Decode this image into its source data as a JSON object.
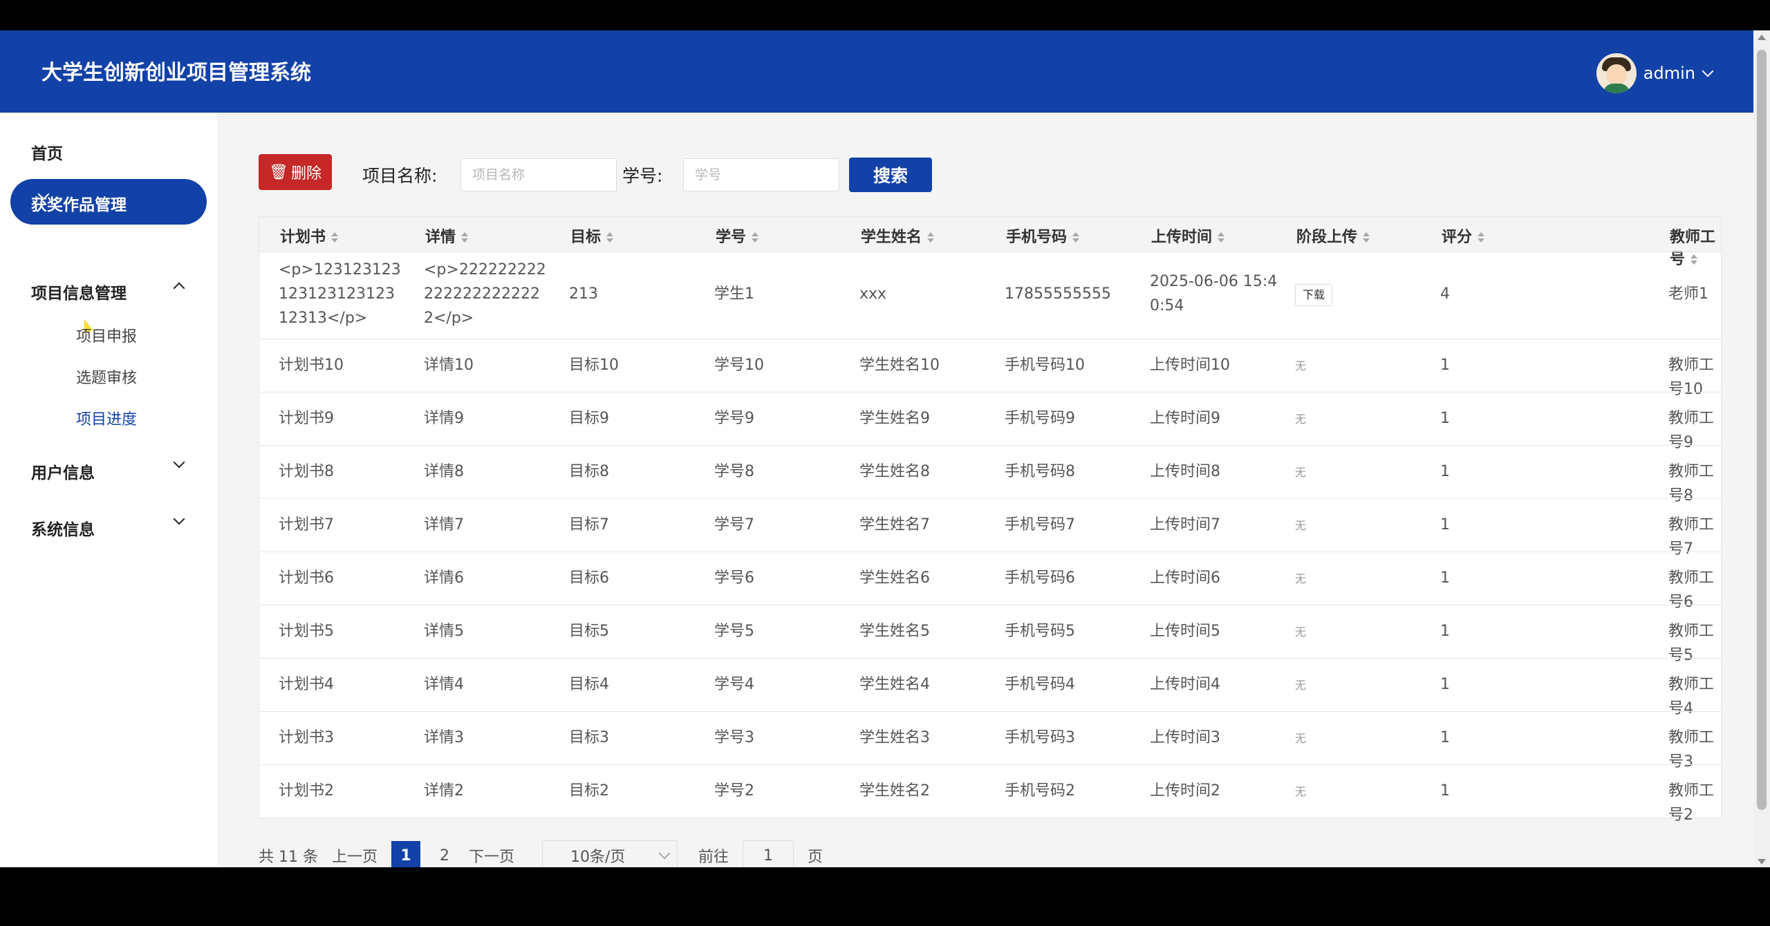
{
  "header": {
    "title": "大学生创新创业项目管理系统",
    "user": "admin"
  },
  "sidebar": {
    "home": "首页",
    "awards": "获奖作品管理",
    "project_info": "项目信息管理",
    "sub": [
      "项目申报",
      "选题审核",
      "项目进度"
    ],
    "user_info": "用户信息",
    "system_info": "系统信息"
  },
  "toolbar": {
    "delete_label": "删除",
    "project_name_label": "项目名称:",
    "project_name_placeholder": "项目名称",
    "student_id_label": "学号:",
    "student_id_placeholder": "学号",
    "search_label": "搜索"
  },
  "table": {
    "headers": [
      "计划书",
      "详情",
      "目标",
      "学号",
      "学生姓名",
      "手机号码",
      "上传时间",
      "阶段上传",
      "评分",
      "教师工号"
    ],
    "rows": [
      [
        "<p>12312312312312312312312313</p>",
        "<p>2222222222222222222222</p>",
        "213",
        "学生1",
        "xxx",
        "17855555555",
        "2025-06-06 15:40:54",
        "下载",
        "4",
        "老师1"
      ],
      [
        "计划书10",
        "详情10",
        "目标10",
        "学号10",
        "学生姓名10",
        "手机号码10",
        "上传时间10",
        "无",
        "1",
        "教师工号10"
      ],
      [
        "计划书9",
        "详情9",
        "目标9",
        "学号9",
        "学生姓名9",
        "手机号码9",
        "上传时间9",
        "无",
        "1",
        "教师工号9"
      ],
      [
        "计划书8",
        "详情8",
        "目标8",
        "学号8",
        "学生姓名8",
        "手机号码8",
        "上传时间8",
        "无",
        "1",
        "教师工号8"
      ],
      [
        "计划书7",
        "详情7",
        "目标7",
        "学号7",
        "学生姓名7",
        "手机号码7",
        "上传时间7",
        "无",
        "1",
        "教师工号7"
      ],
      [
        "计划书6",
        "详情6",
        "目标6",
        "学号6",
        "学生姓名6",
        "手机号码6",
        "上传时间6",
        "无",
        "1",
        "教师工号6"
      ],
      [
        "计划书5",
        "详情5",
        "目标5",
        "学号5",
        "学生姓名5",
        "手机号码5",
        "上传时间5",
        "无",
        "1",
        "教师工号5"
      ],
      [
        "计划书4",
        "详情4",
        "目标4",
        "学号4",
        "学生姓名4",
        "手机号码4",
        "上传时间4",
        "无",
        "1",
        "教师工号4"
      ],
      [
        "计划书3",
        "详情3",
        "目标3",
        "学号3",
        "学生姓名3",
        "手机号码3",
        "上传时间3",
        "无",
        "1",
        "教师工号3"
      ],
      [
        "计划书2",
        "详情2",
        "目标2",
        "学号2",
        "学生姓名2",
        "手机号码2",
        "上传时间2",
        "无",
        "1",
        "教师工号2"
      ]
    ]
  },
  "pagination": {
    "total": "共 11 条",
    "prev": "上一页",
    "pages": [
      "1",
      "2"
    ],
    "next": "下一页",
    "page_size": "10条/页",
    "goto": "前往",
    "goto_value": "1",
    "page_unit": "页"
  },
  "colors": {
    "primary": "#1241a8",
    "danger": "#c62828"
  }
}
